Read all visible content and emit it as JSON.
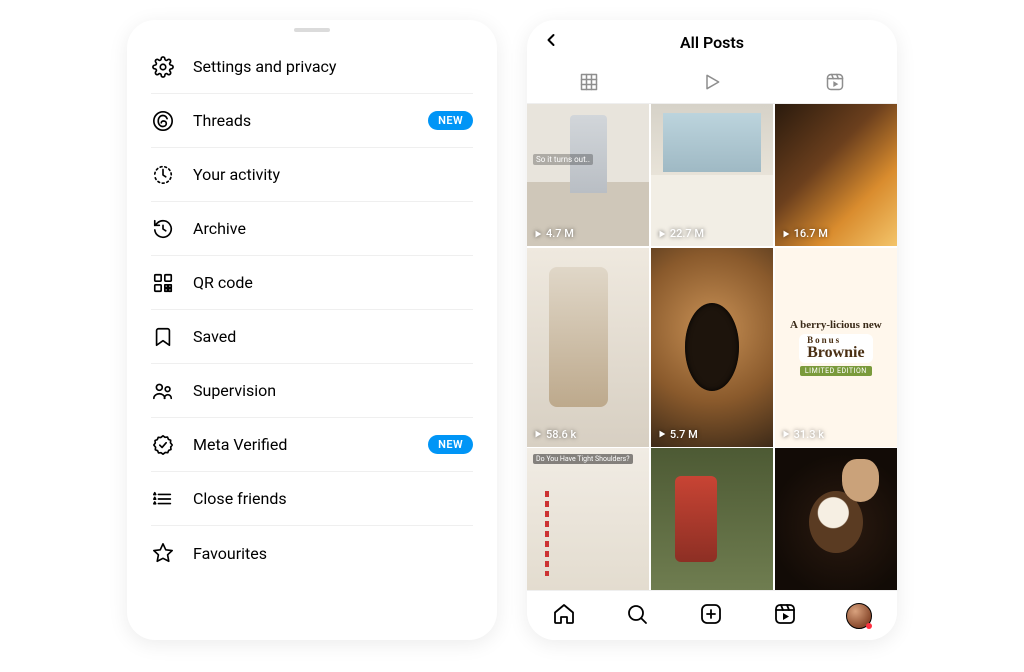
{
  "left": {
    "menu": [
      {
        "icon": "gear",
        "label": "Settings and privacy",
        "badge": null
      },
      {
        "icon": "threads",
        "label": "Threads",
        "badge": "NEW"
      },
      {
        "icon": "activity",
        "label": "Your activity",
        "badge": null
      },
      {
        "icon": "archive",
        "label": "Archive",
        "badge": null
      },
      {
        "icon": "qr",
        "label": "QR code",
        "badge": null
      },
      {
        "icon": "saved",
        "label": "Saved",
        "badge": null
      },
      {
        "icon": "supervision",
        "label": "Supervision",
        "badge": null
      },
      {
        "icon": "verified",
        "label": "Meta Verified",
        "badge": "NEW"
      },
      {
        "icon": "closefriends",
        "label": "Close friends",
        "badge": null
      },
      {
        "icon": "star",
        "label": "Favourites",
        "badge": null
      }
    ]
  },
  "right": {
    "title": "All Posts",
    "tabs": [
      "grid",
      "play",
      "reels"
    ],
    "posts": [
      {
        "views": "4.7 M",
        "overlay": "So it turns out..",
        "bg": "bg1"
      },
      {
        "views": "22.7 M",
        "overlay": null,
        "bg": "bg2"
      },
      {
        "views": "16.7 M",
        "overlay": null,
        "bg": "bg3"
      },
      {
        "views": "58.6 k",
        "overlay": null,
        "bg": "bg4"
      },
      {
        "views": "5.7 M",
        "overlay": null,
        "bg": "bg5"
      },
      {
        "views": "31.3 k",
        "promo": {
          "top": "A berry-licious new",
          "mid1": "Bonus",
          "mid2": "Brownie",
          "tag": "LIMITED EDITION"
        },
        "bg": "bg6"
      },
      {
        "views": null,
        "overlay_top": "Do You Have Tight Shoulders?",
        "bg": "bg7"
      },
      {
        "views": null,
        "overlay": null,
        "bg": "bg8"
      },
      {
        "views": null,
        "overlay": null,
        "bg": "bg9"
      }
    ],
    "nav": [
      "home",
      "search",
      "create",
      "reels",
      "profile"
    ]
  }
}
